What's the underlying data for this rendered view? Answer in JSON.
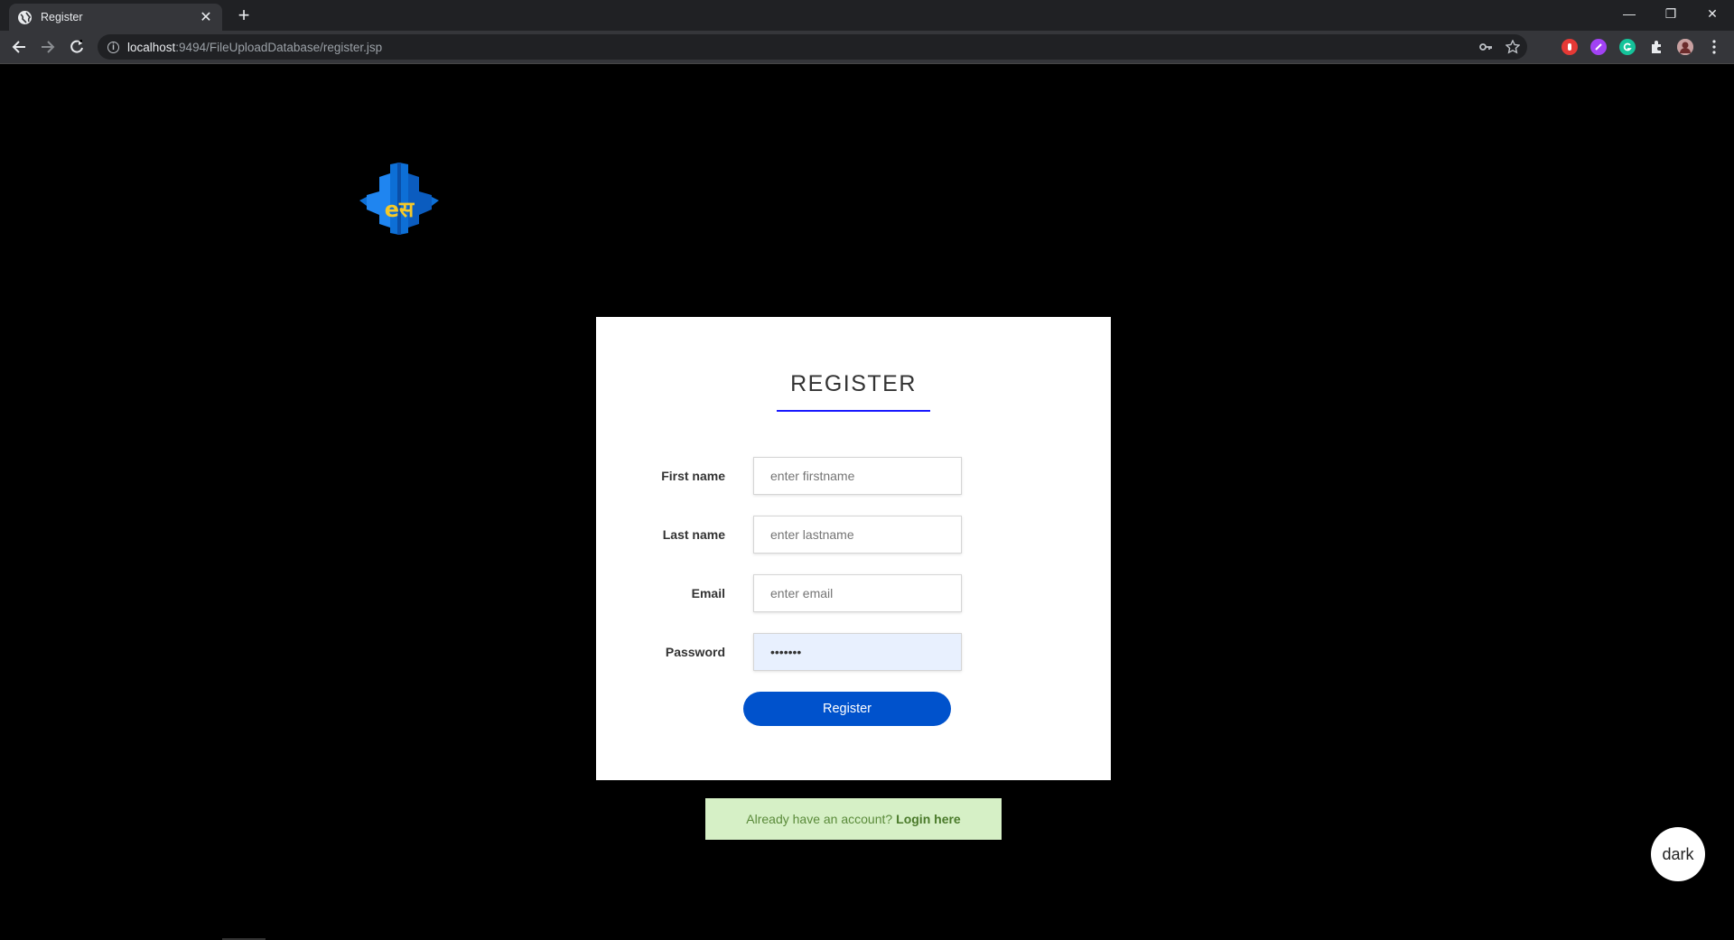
{
  "browser": {
    "tab_title": "Register",
    "tab_close": "✕",
    "new_tab": "+",
    "url_host": "localhost",
    "url_rest": ":9494/FileUploadDatabase/register.jsp",
    "window_controls": {
      "minimize": "—",
      "restore": "❐",
      "close": "✕"
    },
    "extension_colors": {
      "red": "#e53935",
      "purple": "#a142f4",
      "green": "#15c39a"
    }
  },
  "logo": {
    "text": "eस",
    "colors": {
      "blue": "#0d6fd6",
      "yellow": "#f6c928"
    }
  },
  "form": {
    "title": "REGISTER",
    "fields": [
      {
        "label": "First name",
        "placeholder": "enter firstname",
        "value": ""
      },
      {
        "label": "Last name",
        "placeholder": "enter lastname",
        "value": ""
      },
      {
        "label": "Email",
        "placeholder": "enter email",
        "value": ""
      },
      {
        "label": "Password",
        "placeholder": "",
        "value": "1234567"
      }
    ],
    "submit_label": "Register"
  },
  "login_prompt": {
    "text": "Already have an account?",
    "link": "Login here"
  },
  "theme_toggle": {
    "label": "dark"
  }
}
